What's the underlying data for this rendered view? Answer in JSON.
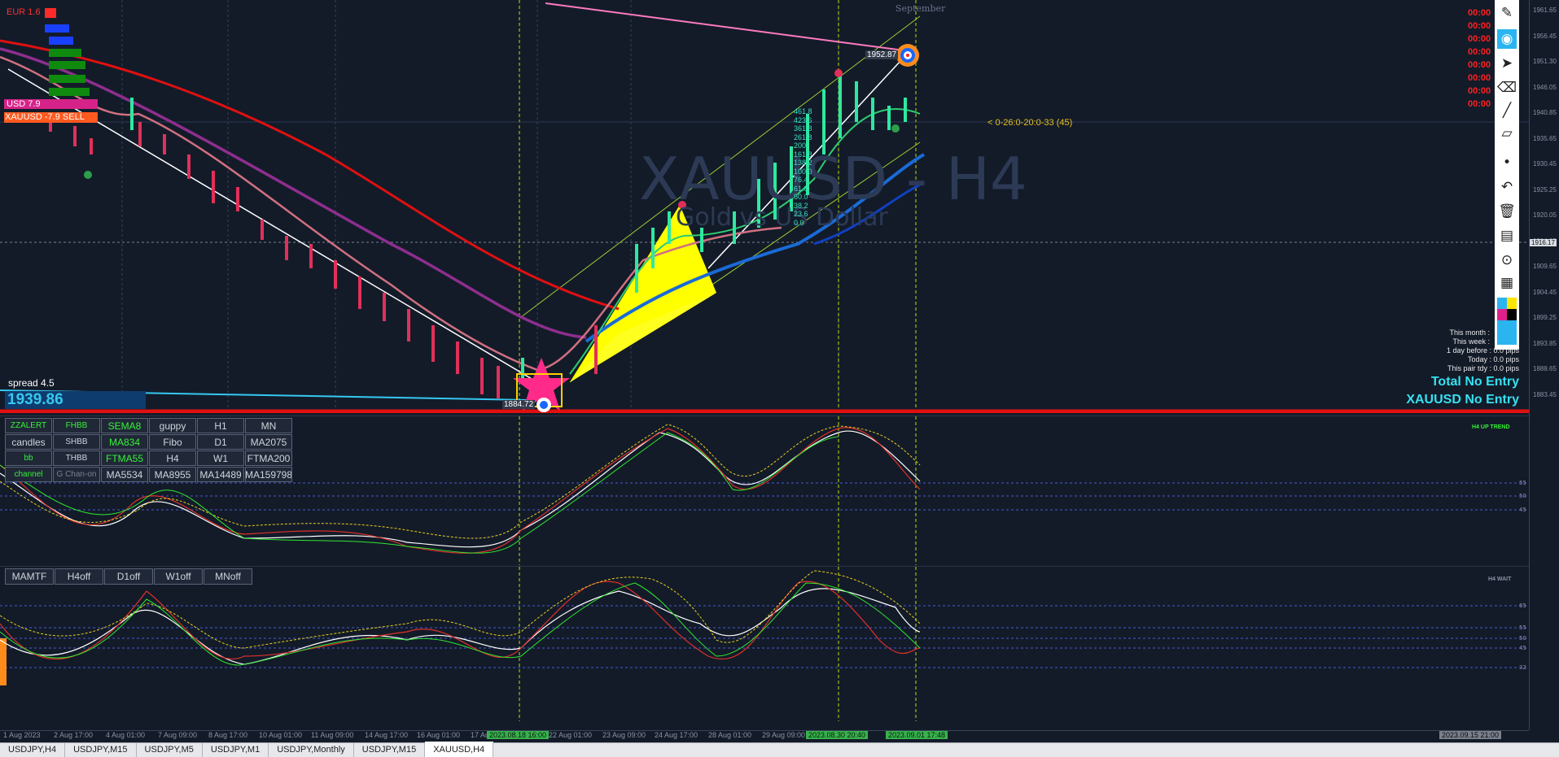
{
  "chart": {
    "symbol_watermark": "XAUUSD - H4",
    "subtitle_watermark": "Gold vs US Dollar",
    "month_label": "September",
    "current_price_box": "1939.86",
    "spread_label": "spread 4.5",
    "fib_levels": [
      "461.8",
      "423.6",
      "361.8",
      "261.8",
      "200",
      "161.8",
      "138.2",
      "100.0",
      "76.4",
      "61.8",
      "50.0",
      "38.2",
      "23.6",
      "0.0"
    ],
    "target_label": "< 0-26:0-20:0-33 (45)",
    "high_label": "1952.87",
    "low_label": "1884.72",
    "xau_label": "XAUUSD -7.9 SELL",
    "usd_label": "USD  7.9",
    "eur_label": "EUR  1.6",
    "crosshair_price": "1916.17"
  },
  "status_panel": {
    "total": "Total No Entry",
    "pair": "XAUUSD No Entry",
    "month": "This month :",
    "week": "This week :",
    "day_before": "1 day before : 0.0 pips",
    "today": "Today : 0.0 pips",
    "pair_tdy": "This pair tdy : 0.0 pips",
    "h4_trend": "H4 UP TREND",
    "h4_wait": "H4 WAIT",
    "timer": "00:00"
  },
  "button_grid": {
    "row1": [
      "ZZALERT",
      "FHBB",
      "SEMA8",
      "guppy",
      "H1",
      "MN"
    ],
    "row2": [
      "candles",
      "SHBB",
      "MA834",
      "Fibo",
      "D1",
      "MA2075"
    ],
    "row3": [
      "bb",
      "THBB",
      "FTMA55",
      "H4",
      "W1",
      "FTMA200"
    ],
    "row4": [
      "channel",
      "G Chan-on",
      "MA5534",
      "MA8955",
      "MA14489",
      "MA159798"
    ]
  },
  "mamtf_buttons": [
    "MAMTF",
    "H4off",
    "D1off",
    "W1off",
    "MNoff"
  ],
  "price_axis": [
    "1961.65",
    "1956.45",
    "1951.30",
    "1946.05",
    "1940.85",
    "1935.65",
    "1930.45",
    "1925.25",
    "1920.05",
    "1914.85",
    "1909.65",
    "1904.45",
    "1899.25",
    "1893.85",
    "1888.65",
    "1883.45"
  ],
  "ind1_levels": [
    "55",
    "50",
    "45"
  ],
  "ind2_levels": [
    "65",
    "55",
    "50",
    "45",
    "32"
  ],
  "time_axis": [
    "1 Aug 2023",
    "2 Aug 17:00",
    "4 Aug 01:00",
    "7 Aug 09:00",
    "8 Aug 17:00",
    "10 Aug 01:00",
    "11 Aug 09:00",
    "14 Aug 17:00",
    "16 Aug 01:00",
    "17 Aug 09:00",
    "2023.08.18 16:00",
    "22 Aug 01:00",
    "23 Aug 09:00",
    "24 Aug 17:00",
    "28 Aug 01:00",
    "29 Aug 09:00",
    "2023.08.30 20:40",
    "2023.09.01 17:48",
    "2023.09.15 21:00"
  ],
  "tabs": [
    "USDJPY,H4",
    "USDJPY,M15",
    "USDJPY,M5",
    "USDJPY,M1",
    "USDJPY,Monthly",
    "USDJPY,M15",
    "XAUUSD,H4"
  ],
  "colors": {
    "bg": "#131b29",
    "red_line": "#e01010",
    "purple_ma": "#8e2e8e",
    "blue_ma": "#1a6bd6",
    "green_ma": "#2ecc71",
    "yellow": "#ffff00"
  }
}
